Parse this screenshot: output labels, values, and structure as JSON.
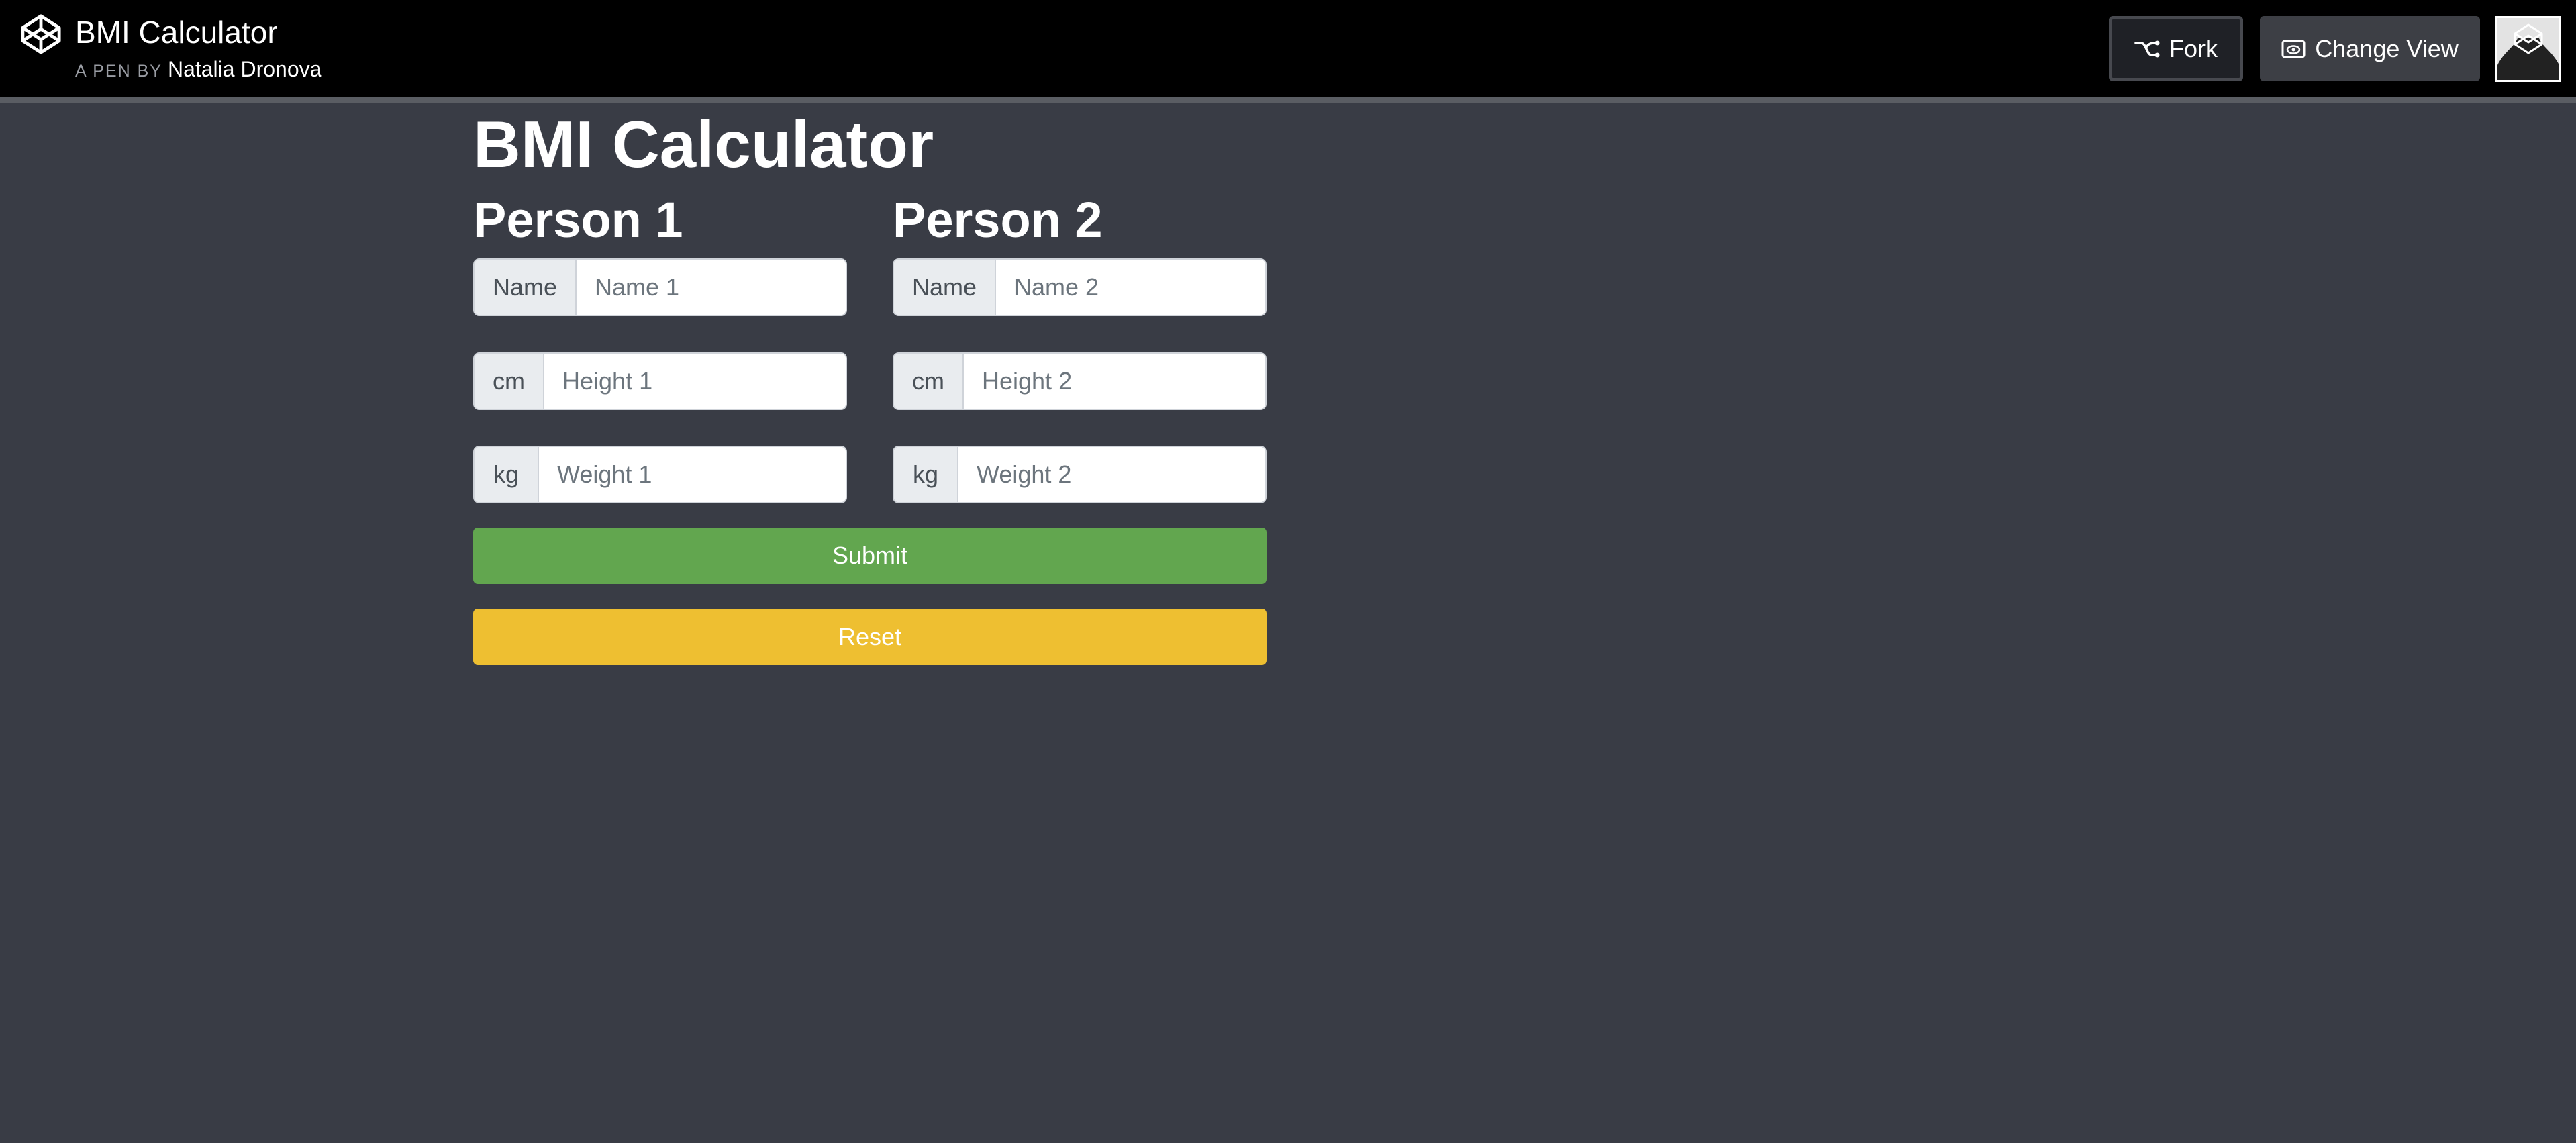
{
  "header": {
    "pen_title": "BMI Calculator",
    "byline_prefix": "A PEN BY",
    "author": "Natalia Dronova",
    "fork_label": "Fork",
    "change_view_label": "Change View",
    "icons": {
      "logo": "codepen-logo-icon",
      "fork": "fork-icon",
      "change_view": "eye-icon",
      "avatar": "user-avatar"
    }
  },
  "app": {
    "title": "BMI Calculator",
    "persons": [
      {
        "heading": "Person 1",
        "name_addon": "Name",
        "name_placeholder": "Name 1",
        "height_addon": "cm",
        "height_placeholder": "Height 1",
        "weight_addon": "kg",
        "weight_placeholder": "Weight 1"
      },
      {
        "heading": "Person 2",
        "name_addon": "Name",
        "name_placeholder": "Name 2",
        "height_addon": "cm",
        "height_placeholder": "Height 2",
        "weight_addon": "kg",
        "weight_placeholder": "Weight 2"
      }
    ],
    "submit_label": "Submit",
    "reset_label": "Reset"
  },
  "colors": {
    "page_background": "#393c45",
    "header_background": "#000000",
    "submit": "#62a64f",
    "reset": "#eebf31"
  }
}
